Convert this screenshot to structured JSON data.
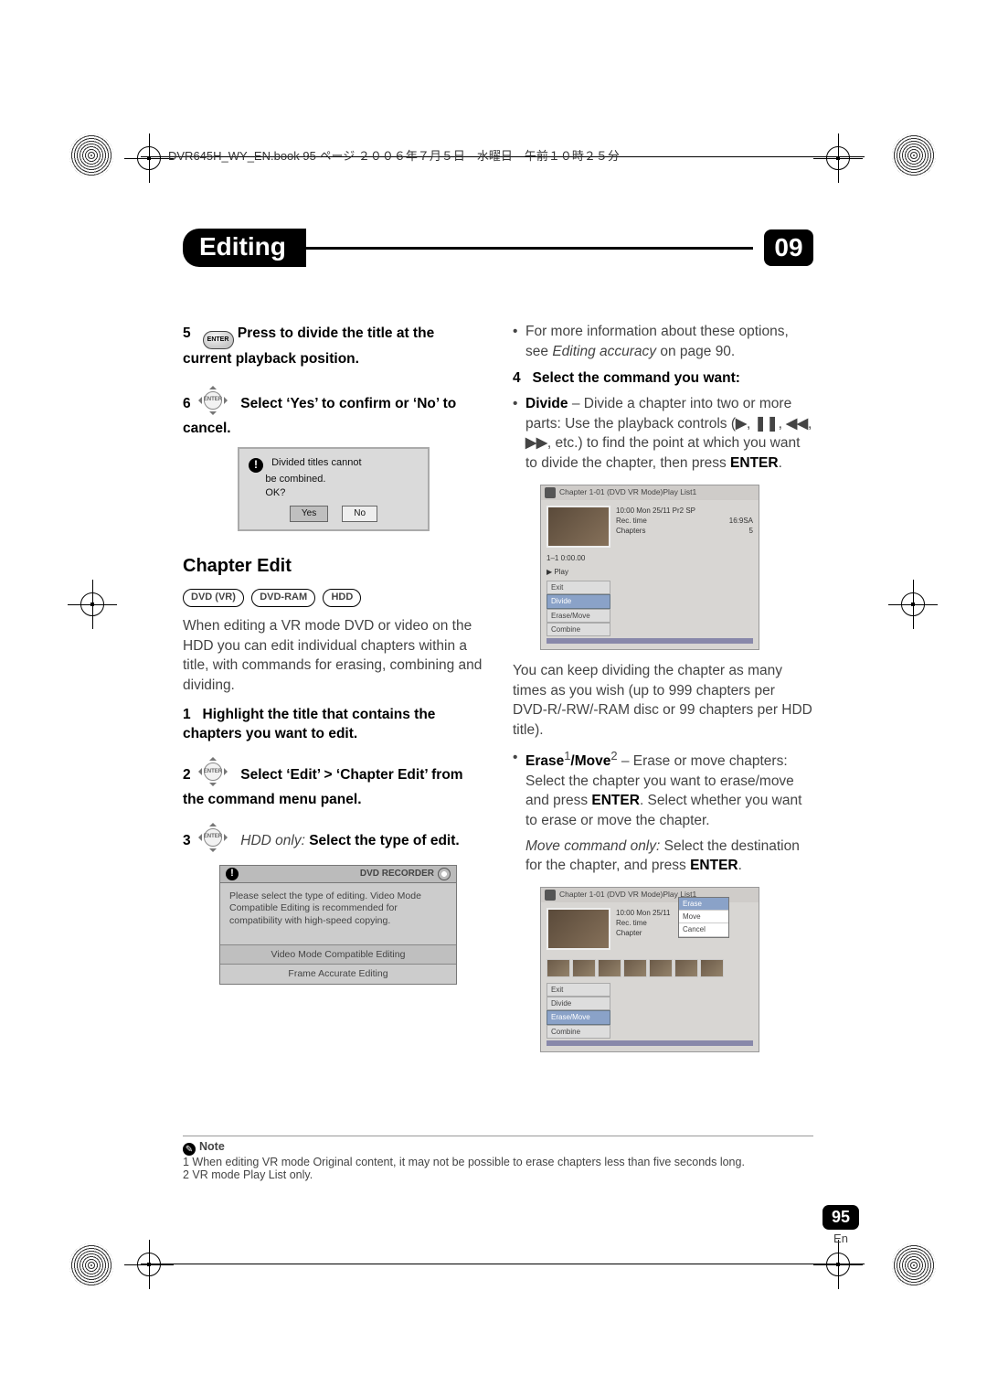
{
  "header_path": "DVR645H_WY_EN.book 95 ページ ２００６年７月５日　水曜日　午前１０時２５分",
  "title": "Editing",
  "chapter_number": "09",
  "left": {
    "step5_num": "5",
    "step5_a": "Press to divide the title at the current playback position.",
    "enter_label": "ENTER",
    "step6_num": "6",
    "step6_a": "Select ‘Yes’ to confirm or ‘No’ to cancel.",
    "dialog1_line1": "Divided titles cannot",
    "dialog1_line2": "be combined.",
    "dialog1_line3": "OK?",
    "dialog1_yes": "Yes",
    "dialog1_no": "No",
    "section": "Chapter Edit",
    "mode1": "DVD (VR)",
    "mode2": "DVD-RAM",
    "mode3": "HDD",
    "para1": "When editing a VR mode DVD or video on the HDD you can edit individual chapters within a title, with commands for erasing, combining and dividing.",
    "step1_num": "1",
    "step1_a": "Highlight the title that contains the chapters you want to edit.",
    "step2_num": "2",
    "step2_a": "Select ‘Edit’ > ‘Chapter Edit’ from the command menu panel.",
    "step3_num": "3",
    "step3_prefix": "HDD only:",
    "step3_a": "Select the type of edit.",
    "rec_title": "DVD RECORDER",
    "rec_body": "Please select the type of editing. Video Mode Compatible Editing is recommended for compatibility with high-speed copying.",
    "rec_opt1": "Video Mode Compatible Editing",
    "rec_opt2": "Frame Accurate Editing"
  },
  "right": {
    "bullet0": "For more information about these options, see ",
    "bullet0_i": "Editing accuracy",
    "bullet0_b": " on page 90.",
    "step4_num": "4",
    "step4_a": "Select the command you want:",
    "divide_label": "Divide",
    "divide_text": " – Divide a chapter into two or more parts: Use the playback controls (",
    "divide_text2": ", etc.) to find the point at which you want to divide the chapter, then press ",
    "enter": "ENTER",
    "tw1_bar": "Chapter 1-01 (DVD VR Mode)Play List1",
    "tw1_date": "10:00 Mon 25/11  Pr2  SP",
    "tw1_rec": "Rec. time",
    "tw1_rec_v": "16:9SA",
    "tw1_ch": "Chapters",
    "tw1_ch_v": "5",
    "tw1_trk": "1–1        0:00.00",
    "tw1_play": "▶ Play",
    "tw1_exit": "Exit",
    "tw1_div": "Divide",
    "tw1_em": "Erase/Move",
    "tw1_cmb": "Combine",
    "after_divide": "You can keep dividing the chapter as many times as you wish (up to 999 chapters per DVD-R/-RW/-RAM disc or 99 chapters per HDD title).",
    "erase_label": "Erase",
    "move_label": "/Move",
    "erase_text": " – Erase or move chapters: Select the chapter you want to erase/move and press ",
    "erase_text2": ". Select whether you want to erase or move the chapter.",
    "move_only_i": "Move command only:",
    "move_only_a": " Select the destination for the chapter, and press ",
    "tw2_bar": "Chapter 1-01 (DVD VR Mode)Play List1",
    "tw2_date": "10:00 Mon 25/11",
    "tw2_rec": "Rec. time",
    "tw2_ch": "Chapter",
    "tw2_p_erase": "Erase",
    "tw2_p_move": "Move",
    "tw2_p_cancel": "Cancel",
    "tw2_exit": "Exit",
    "tw2_div": "Divide",
    "tw2_em": "Erase/Move",
    "tw2_cmb": "Combine"
  },
  "footnotes": {
    "label": "Note",
    "n1": "1 When editing VR mode Original content, it may not be possible to erase chapters less than five seconds long.",
    "n2": "2 VR mode Play List only."
  },
  "page_number": "95",
  "page_lang": "En"
}
